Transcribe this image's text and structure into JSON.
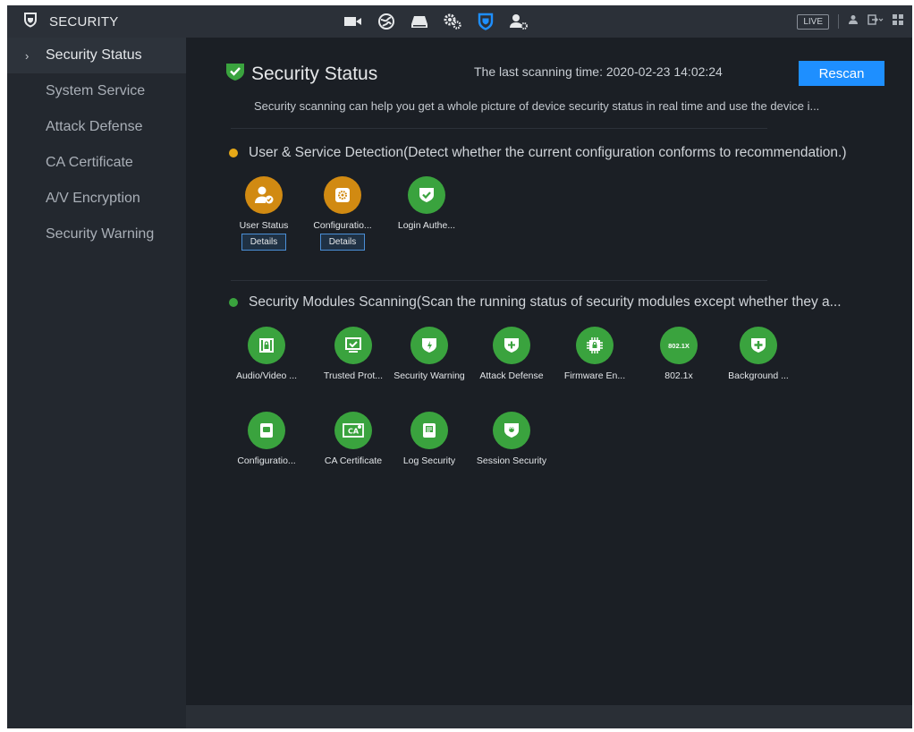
{
  "app": {
    "title": "SECURITY"
  },
  "topbar": {
    "icons": [
      "camera-icon",
      "network-globe-icon",
      "storage-icon",
      "system-gears-icon",
      "security-shield-icon",
      "account-icon"
    ],
    "live_label": "LIVE",
    "right_icons": [
      "user-icon",
      "logout-icon",
      "grid-menu-icon"
    ]
  },
  "sidebar": {
    "items": [
      {
        "label": "Security Status",
        "active": true
      },
      {
        "label": "System Service"
      },
      {
        "label": "Attack Defense"
      },
      {
        "label": "CA Certificate"
      },
      {
        "label": "A/V Encryption"
      },
      {
        "label": "Security Warning"
      }
    ]
  },
  "main": {
    "title": "Security Status",
    "scan_time": "The last scanning time: 2020-02-23 14:02:24",
    "rescan_label": "Rescan",
    "description": "Security scanning can help you get a whole picture of device security status in real time and use the device i...",
    "user_service": {
      "title": "User & Service Detection(Detect whether the current configuration conforms to recommendation.)",
      "status_color": "#e6a817",
      "items": [
        {
          "label": "User Status",
          "status": "warning",
          "icon": "user-check-icon",
          "details": "Details"
        },
        {
          "label": "Configuratio...",
          "status": "warning",
          "icon": "config-shield-icon",
          "details": "Details"
        },
        {
          "label": "Login Authe...",
          "status": "ok",
          "icon": "check-shield-icon"
        }
      ]
    },
    "modules": {
      "title": "Security Modules Scanning(Scan the running status of security modules except whether they a...",
      "status_color": "#3aa33e",
      "items": [
        {
          "label": "Audio/Video ...",
          "icon": "av-lock-icon"
        },
        {
          "label": "Trusted Prot...",
          "icon": "trusted-monitor-icon"
        },
        {
          "label": "Security Warning",
          "icon": "warning-bolt-icon"
        },
        {
          "label": "Attack Defense",
          "icon": "defense-plus-icon"
        },
        {
          "label": "Firmware En...",
          "icon": "firmware-chip-icon"
        },
        {
          "label": "802.1x",
          "icon": "8021x-icon",
          "icon_text": "802.1X"
        },
        {
          "label": "Background ...",
          "icon": "background-shield-icon"
        },
        {
          "label": "Configuratio...",
          "icon": "config-doc-icon"
        },
        {
          "label": "CA Certificate",
          "icon": "ca-certificate-icon",
          "icon_text": "CA"
        },
        {
          "label": "Log Security",
          "icon": "log-doc-icon"
        },
        {
          "label": "Session Security",
          "icon": "session-shield-icon"
        }
      ]
    }
  },
  "colors": {
    "accent": "#1e8fff",
    "ok": "#3aa33e",
    "warning": "#d18a12",
    "background": "#1b1f25",
    "sidebar": "#23282f"
  }
}
